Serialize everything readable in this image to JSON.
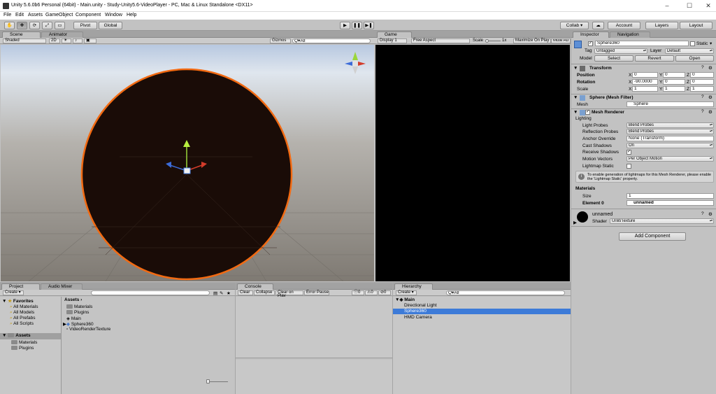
{
  "window": {
    "title": "Unity 5.6.0b6 Personal (64bit) - Main.unity - Study-Unity5.6-VideoPlayer - PC, Mac & Linux Standalone <DX11>",
    "minimize": "–",
    "maximize": "☐",
    "close": "✕"
  },
  "menu": [
    "File",
    "Edit",
    "Assets",
    "GameObject",
    "Component",
    "Window",
    "Help"
  ],
  "toolbar": {
    "tools": [
      "✋",
      "✥",
      "⟳",
      "⤢",
      "▭"
    ],
    "pivot": "Pivot",
    "global": "Global",
    "play": "▶",
    "pause": "❚❚",
    "step": "▶❚",
    "collab": "Collab ▾",
    "cloud": "☁",
    "account": "Account",
    "layers": "Layers",
    "layout": "Layout"
  },
  "scene": {
    "tab_scene": "Scene",
    "tab_animator": "Animator",
    "shaded": "Shaded",
    "mode2d": "2D",
    "gizmos": "Gizmos",
    "search_placeholder": "Q▾All"
  },
  "game": {
    "tab": "Game",
    "display": "Display 1",
    "aspect": "Free Aspect",
    "scale_label": "Scale",
    "scale_value": "1x",
    "maximize": "Maximize On Play",
    "mute": "Mute Au"
  },
  "inspector": {
    "tab": "Inspector",
    "tab_nav": "Navigation",
    "object_name": "Sphere360",
    "static_label": "Static",
    "tag_label": "Tag",
    "tag_value": "Untagged",
    "layer_label": "Layer",
    "layer_value": "Default",
    "model_label": "Model",
    "select": "Select",
    "revert": "Revert",
    "open": "Open",
    "transform": {
      "title": "Transform",
      "position": "Position",
      "rotation": "Rotation",
      "scale": "Scale",
      "pos": [
        "0",
        "0",
        "0"
      ],
      "rot": [
        "-90.0000",
        "0",
        "0"
      ],
      "scl": [
        "1",
        "1",
        "1"
      ]
    },
    "meshfilter": {
      "title": "Sphere (Mesh Filter)",
      "mesh_label": "Mesh",
      "mesh_value": "Sphere"
    },
    "renderer": {
      "title": "Mesh Renderer",
      "lighting": "Lighting",
      "light_probes": "Light Probes",
      "light_probes_val": "Blend Probes",
      "reflection_probes": "Reflection Probes",
      "reflection_probes_val": "Blend Probes",
      "anchor": "Anchor Override",
      "anchor_val": "None (Transform)",
      "cast": "Cast Shadows",
      "cast_val": "On",
      "receive": "Receive Shadows",
      "motion": "Motion Vectors",
      "motion_val": "Per Object Motion",
      "lightmap_static": "Lightmap Static",
      "info": "To enable generation of lightmaps for this Mesh Renderer, please enable the 'Lightmap Static' property.",
      "materials": "Materials",
      "size_label": "Size",
      "size_val": "1",
      "element0": "Element 0",
      "element0_val": "unnamed"
    },
    "material": {
      "name": "unnamed",
      "shader_label": "Shader",
      "shader_val": "Unlit/Texture"
    },
    "add_component": "Add Component"
  },
  "project": {
    "tab": "Project",
    "tab_audio": "Audio Mixer",
    "create": "Create ▾",
    "favorites": "Favorites",
    "fav_items": [
      "All Materials",
      "All Models",
      "All Prefabs",
      "All Scripts"
    ],
    "assets_root": "Assets",
    "asset_folders": [
      "Materials",
      "Plugins"
    ],
    "breadcrumb": "Assets ›",
    "files": [
      "Materials",
      "Plugins",
      "Main",
      "Sphere360",
      "VideoRenderTexture"
    ]
  },
  "console": {
    "tab": "Console",
    "clear": "Clear",
    "collapse": "Collapse",
    "clear_on_play": "Clear on Play",
    "error_pause": "Error Pause",
    "count_info": "0",
    "count_warn": "0",
    "count_err": "0"
  },
  "hierarchy": {
    "tab": "Hierarchy",
    "create": "Create ▾",
    "search": "Q▾All",
    "scene_name": "Main",
    "items": [
      "Directional Light",
      "Sphere360",
      "HMD Camera"
    ]
  },
  "colors": {
    "selection": "#3d7bd8",
    "sphere_edge": "#f26a12",
    "sphere_fill": "#1a0c07"
  }
}
